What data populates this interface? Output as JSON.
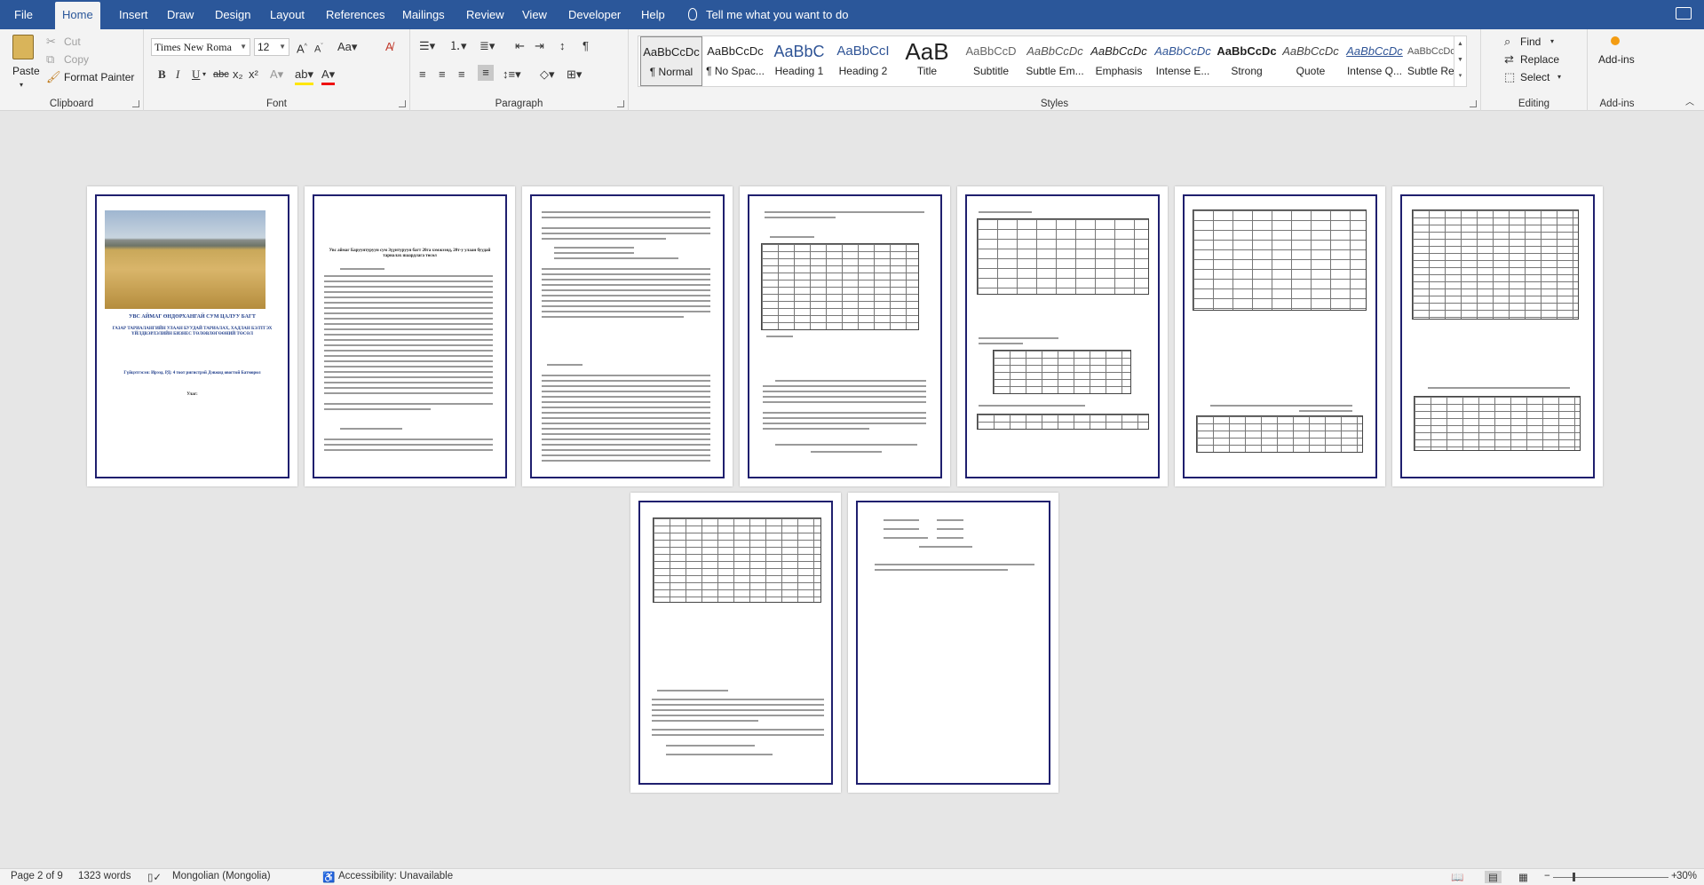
{
  "menubar": {
    "tabs": [
      "File",
      "Home",
      "Insert",
      "Draw",
      "Design",
      "Layout",
      "References",
      "Mailings",
      "Review",
      "View",
      "Developer",
      "Help"
    ],
    "active_tab": "Home",
    "tell_me": "Tell me what you want to do"
  },
  "ribbon": {
    "clipboard": {
      "paste": "Paste",
      "cut": "Cut",
      "copy": "Copy",
      "format_painter": "Format Painter",
      "label": "Clipboard"
    },
    "font": {
      "name": "Times New Roma",
      "size": "12",
      "label": "Font",
      "buttons": [
        "B",
        "I",
        "U",
        "abc",
        "x₂",
        "x²"
      ]
    },
    "paragraph": {
      "label": "Paragraph"
    },
    "styles": {
      "label": "Styles",
      "items": [
        {
          "preview": "AaBbCcDc",
          "name": "¶ Normal"
        },
        {
          "preview": "AaBbCcDc",
          "name": "¶ No Spac..."
        },
        {
          "preview": "AaBbC",
          "name": "Heading 1"
        },
        {
          "preview": "AaBbCcI",
          "name": "Heading 2"
        },
        {
          "preview": "AaB",
          "name": "Title"
        },
        {
          "preview": "AaBbCcD",
          "name": "Subtitle"
        },
        {
          "preview": "AaBbCcDc",
          "name": "Subtle Em..."
        },
        {
          "preview": "AaBbCcDc",
          "name": "Emphasis"
        },
        {
          "preview": "AaBbCcDc",
          "name": "Intense E..."
        },
        {
          "preview": "AaBbCcDc",
          "name": "Strong"
        },
        {
          "preview": "AaBbCcDc",
          "name": "Quote"
        },
        {
          "preview": "AaBbCcDc",
          "name": "Intense Q..."
        },
        {
          "preview": "AaBbCcDc",
          "name": "Subtle Ref..."
        }
      ]
    },
    "editing": {
      "find": "Find",
      "replace": "Replace",
      "select": "Select",
      "label": "Editing"
    },
    "addins": {
      "button": "Add-ins",
      "label": "Add-ins"
    }
  },
  "document": {
    "cover_title": "УВС АЙМАГ ӨНДӨРХАНГАЙ СУМ ЦАЛУУ БАГТ",
    "cover_subtitle": "ГАЗАР ТАРИАЛАНГИЙН УЛААН БУУДАЙ ТАРИАЛАХ, ХАДЛАН БЭЛТГЭХ ҮЙЛДВЭРЛЭЛИЙН БИЗНЕС ТӨЛӨВЛӨГӨӨНИЙ ТӨСӨЛ",
    "cover_author": "Гүйцэтгэсэн: Ирээд. РД: 4 тоот ригистрэй Дэвжид овогтой Батмөрөл",
    "cover_place": "Улаг:",
    "page2_title": "Увс аймаг Баруунтуруун сум Зүүнтуруун багт 20га хэмжээнд, 20т-у улаан буудай тариалах шаардлага төсөл"
  },
  "status": {
    "page": "Page 2 of 9",
    "words": "1323 words",
    "language": "Mongolian (Mongolia)",
    "accessibility": "Accessibility: Unavailable",
    "zoom": "30%"
  }
}
